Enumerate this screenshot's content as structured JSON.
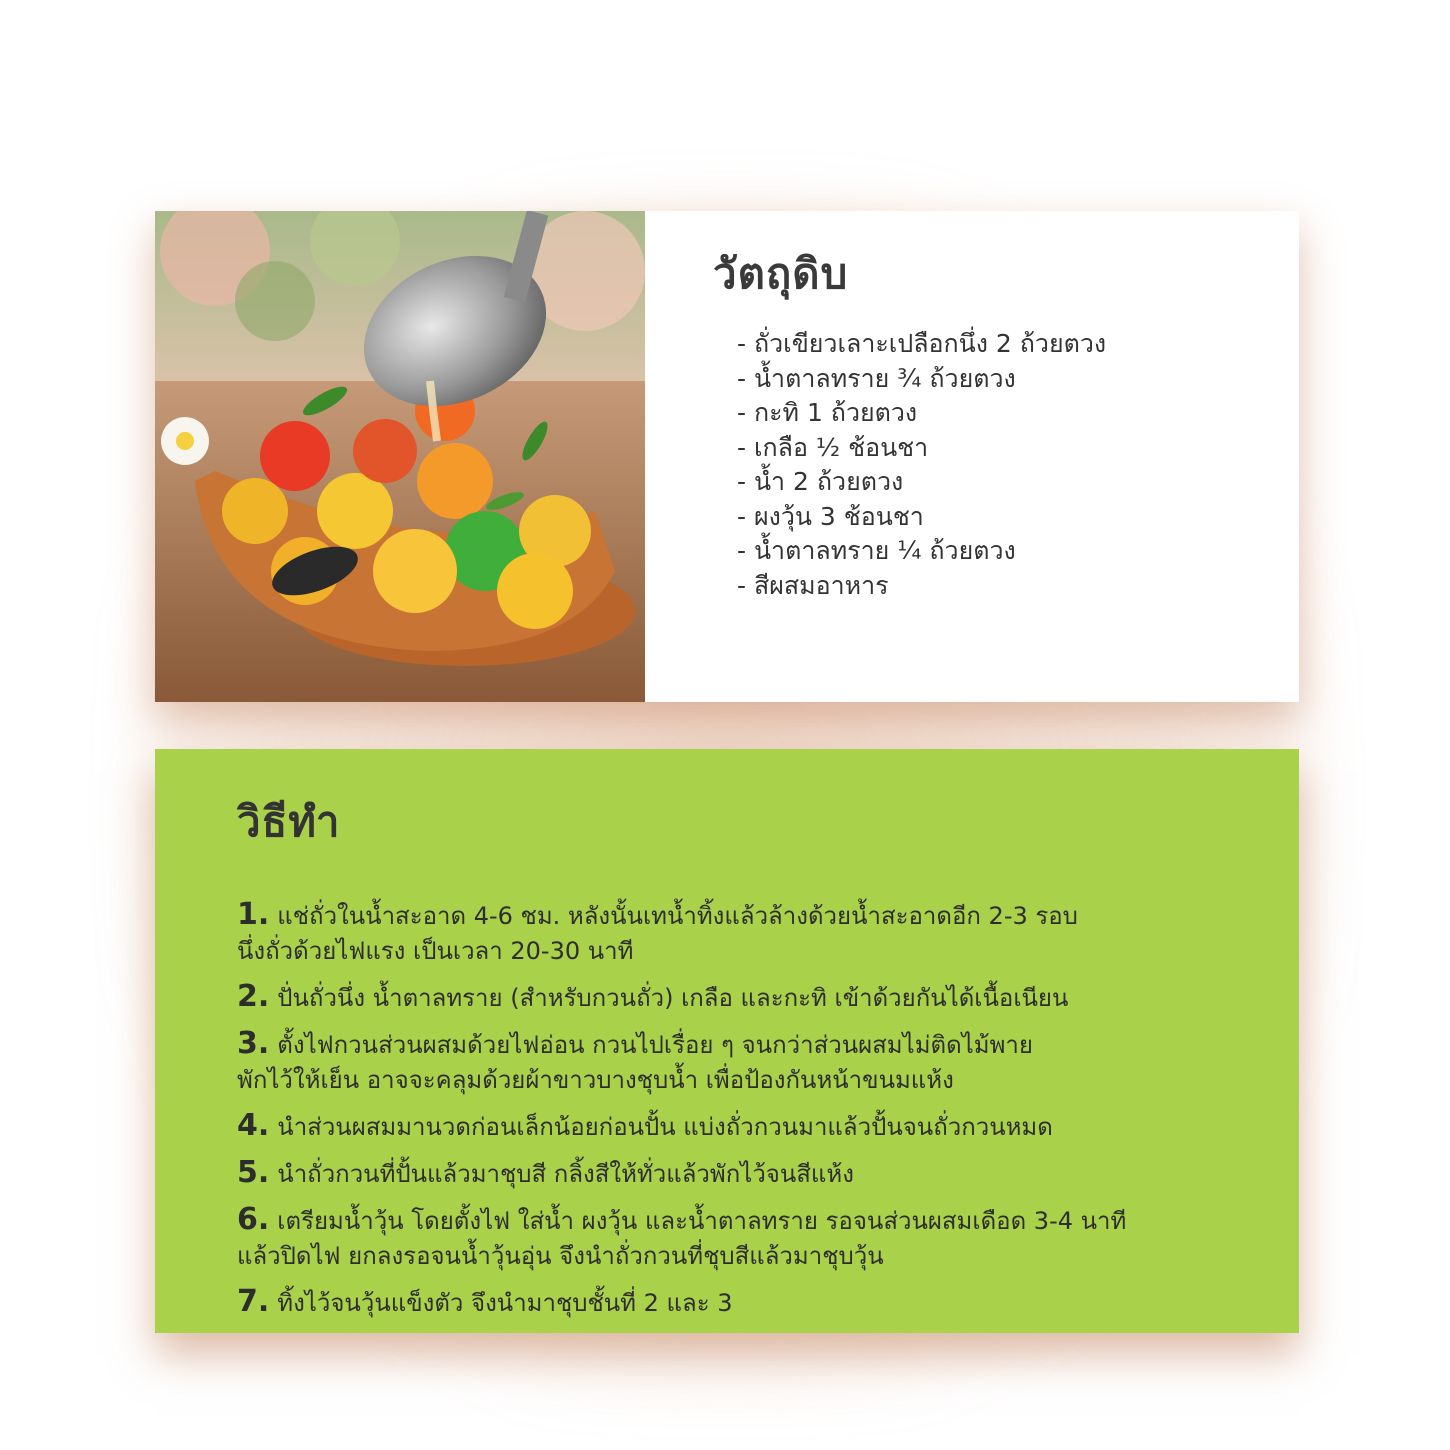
{
  "ingredients": {
    "title": "วัตถุดิบ",
    "items": [
      "ถั่วเขียวเลาะเปลือกนึ่ง 2 ถ้วยตวง",
      "น้ำตาลทราย ¾ ถ้วยตวง",
      "กะทิ 1 ถ้วยตวง",
      "เกลือ ½ ช้อนชา",
      "น้ำ 2 ถ้วยตวง",
      "ผงวุ้น 3 ช้อนชา",
      "น้ำตาลทราย ¼ ถ้วยตวง",
      "สีผสมอาหาร"
    ]
  },
  "method": {
    "title": "วิธีทำ",
    "steps": [
      {
        "num": "1.",
        "line1": "แช่ถั่วในน้ำสะอาด 4-6 ชม. หลังนั้นเทน้ำทิ้งแล้วล้างด้วยน้ำสะอาดอีก 2-3 รอบ",
        "line2": "นึ่งถั่วด้วยไฟแรง เป็นเวลา 20-30 นาที"
      },
      {
        "num": "2.",
        "line1": "ปั่นถั่วนึ่ง น้ำตาลทราย (สำหรับกวนถั่ว) เกลือ และกะทิ เข้าด้วยกันได้เนื้อเนียน",
        "line2": ""
      },
      {
        "num": "3.",
        "line1": "ตั้งไฟกวนส่วนผสมด้วยไฟอ่อน กวนไปเรื่อย ๆ จนกว่าส่วนผสมไม่ติดไม้พาย",
        "line2": "พักไว้ให้เย็น อาจจะคลุมด้วยผ้าขาวบางชุบน้ำ เพื่อป้องกันหน้าขนมแห้ง"
      },
      {
        "num": "4.",
        "line1": "นำส่วนผสมมานวดก่อนเล็กน้อยก่อนปั้น แบ่งถั่วกวนมาแล้วปั้นจนถั่วกวนหมด",
        "line2": ""
      },
      {
        "num": "5.",
        "line1": "นำถั่วกวนที่ปั้นแล้วมาชุบสี กลิ้งสีให้ทั่วแล้วพักไว้จนสีแห้ง",
        "line2": ""
      },
      {
        "num": "6.",
        "line1": "เตรียมน้ำวุ้น โดยตั้งไฟ ใส่น้ำ ผงวุ้น และน้ำตาลทราย รอจนส่วนผสมเดือด 3-4 นาที",
        "line2": "แล้วปิดไฟ ยกลงรอจนน้ำวุ้นอุ่น จึงนำถั่วกวนที่ชุบสีแล้วมาชุบวุ้น"
      },
      {
        "num": "7.",
        "line1": "ทิ้งไว้จนวุ้นแข็งตัว จึงนำมาชุบชั้นที่ 2 และ 3",
        "line2": ""
      }
    ]
  },
  "colors": {
    "method_bg": "#aad14a",
    "shadow": "#d6966e"
  }
}
